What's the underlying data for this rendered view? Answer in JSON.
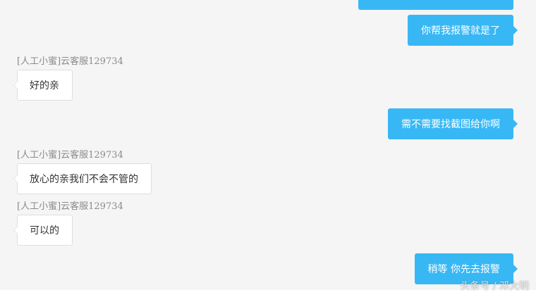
{
  "colors": {
    "incoming_bubble": "#ffffff",
    "outgoing_bubble": "#37b8f5",
    "background": "#f5f5f5",
    "sender_text": "#8a8a8a"
  },
  "messages": [
    {
      "direction": "outgoing",
      "text": "你帮我报警就是了"
    },
    {
      "direction": "incoming",
      "sender": "[人工小蜜]云客服129734",
      "text": "好的亲"
    },
    {
      "direction": "outgoing",
      "text": "需不需要找截图给你啊"
    },
    {
      "direction": "incoming",
      "sender": "[人工小蜜]云客服129734",
      "text": "放心的亲我们不会不管的"
    },
    {
      "direction": "incoming",
      "sender": "[人工小蜜]云客服129734",
      "text": "可以的"
    },
    {
      "direction": "outgoing",
      "text": "稍等  你先去报警"
    }
  ],
  "watermark": "头条号 / 邓大明"
}
